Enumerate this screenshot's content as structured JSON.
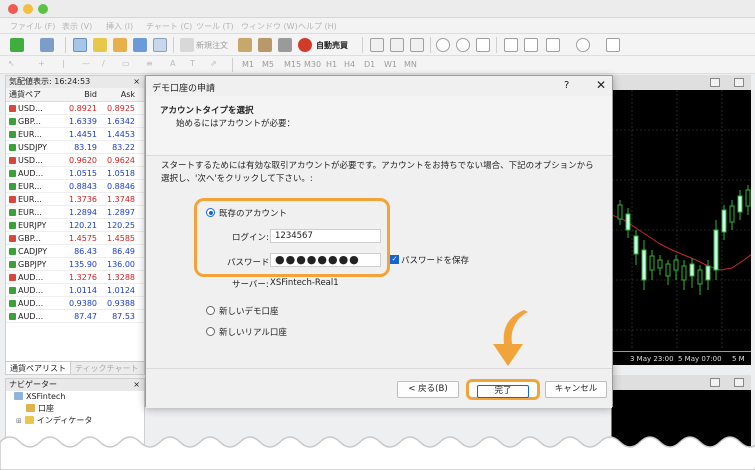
{
  "menu": [
    "ファイル (F)",
    "表示 (V)",
    "挿入 (I)",
    "チャート (C)",
    "ツール (T)",
    "ウィンドウ (W)",
    "ヘルプ (H)"
  ],
  "toolbar": {
    "new_order": "新規注文",
    "auto_trade": "自動売買",
    "timeframes": [
      "M1",
      "M5",
      "M15",
      "M30",
      "H1",
      "H4",
      "D1",
      "W1",
      "MN"
    ]
  },
  "market_watch": {
    "title": "気配値表示: 16:24:53",
    "col_symbol": "通貨ペア",
    "col_bid": "Bid",
    "col_ask": "Ask",
    "rows": [
      {
        "symbol": "USD...",
        "bid": "0.8921",
        "ask": "0.8925",
        "dir": "dn"
      },
      {
        "symbol": "GBP...",
        "bid": "1.6339",
        "ask": "1.6342",
        "dir": "up"
      },
      {
        "symbol": "EUR...",
        "bid": "1.4451",
        "ask": "1.4453",
        "dir": "up"
      },
      {
        "symbol": "USDJPY",
        "bid": "83.19",
        "ask": "83.22",
        "dir": "up"
      },
      {
        "symbol": "USD...",
        "bid": "0.9620",
        "ask": "0.9624",
        "dir": "dn"
      },
      {
        "symbol": "AUD...",
        "bid": "1.0515",
        "ask": "1.0518",
        "dir": "up"
      },
      {
        "symbol": "EUR...",
        "bid": "0.8843",
        "ask": "0.8846",
        "dir": "up"
      },
      {
        "symbol": "EUR...",
        "bid": "1.3736",
        "ask": "1.3748",
        "dir": "dn"
      },
      {
        "symbol": "EUR...",
        "bid": "1.2894",
        "ask": "1.2897",
        "dir": "up"
      },
      {
        "symbol": "EURJPY",
        "bid": "120.21",
        "ask": "120.25",
        "dir": "up"
      },
      {
        "symbol": "GBP...",
        "bid": "1.4575",
        "ask": "1.4585",
        "dir": "dn"
      },
      {
        "symbol": "CADJPY",
        "bid": "86.43",
        "ask": "86.49",
        "dir": "up"
      },
      {
        "symbol": "GBPJPY",
        "bid": "135.90",
        "ask": "136.00",
        "dir": "up"
      },
      {
        "symbol": "AUD...",
        "bid": "1.3276",
        "ask": "1.3288",
        "dir": "dn"
      },
      {
        "symbol": "AUD...",
        "bid": "1.0114",
        "ask": "1.0124",
        "dir": "up"
      },
      {
        "symbol": "AUD...",
        "bid": "0.9380",
        "ask": "0.9388",
        "dir": "up"
      },
      {
        "symbol": "AUD...",
        "bid": "87.47",
        "ask": "87.53",
        "dir": "up"
      }
    ],
    "tab_active": "通貨ペアリスト",
    "tab_inactive": "ティックチャート"
  },
  "navigator": {
    "title": "ナビゲーター",
    "root": "XSFintech",
    "item1": "口座",
    "item2": "インディケータ"
  },
  "chart": {
    "time_labels": [
      "3 May 23:00",
      "5 May 07:00",
      "5 M"
    ]
  },
  "dialog": {
    "title": "デモ口座の申請",
    "help": "?",
    "close": "✕",
    "heading": "アカウントタイプを選択",
    "subheading": "始めるにはアカウントが必要：",
    "description": "スタートするためには有効な取引アカウントが必要です。アカウントをお持ちでない場合、下記のオプションから選択し、'次へ'をクリックして下さい。:",
    "option_existing": "既存のアカウント",
    "login_label": "ログイン:",
    "login_value": "1234567",
    "password_label": "パスワード:",
    "password_value": "●●●●●●●●",
    "save_password": "パスワードを保存",
    "server_label": "サーバー:",
    "server_value": "XSFintech-Real1",
    "option_new_demo": "新しいデモ口座",
    "option_new_real": "新しいリアル口座",
    "back_button": "< 戻る(B)",
    "finish_button": "完了",
    "cancel_button": "キャンセル"
  },
  "colors": {
    "highlight": "#f2a43a",
    "accent_blue": "#1464d8",
    "bid_up": "#1b3cc8",
    "bid_down": "#d12222"
  }
}
